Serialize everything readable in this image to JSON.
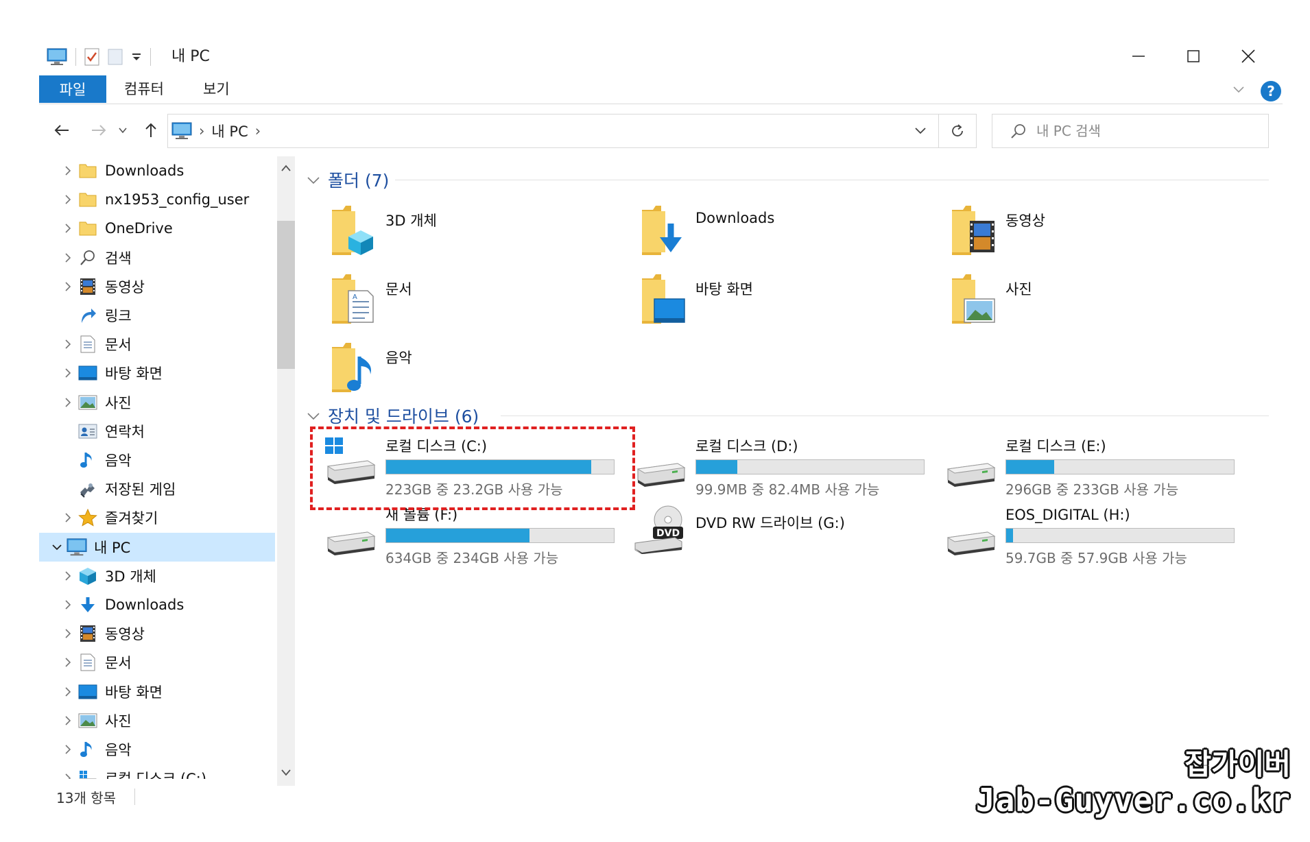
{
  "window": {
    "title": "내 PC"
  },
  "ribbon": {
    "tabs": [
      {
        "label": "파일"
      },
      {
        "label": "컴퓨터"
      },
      {
        "label": "보기"
      }
    ]
  },
  "address_bar": {
    "path": [
      "내 PC"
    ]
  },
  "search": {
    "placeholder": "내 PC 검색"
  },
  "nav_tree": [
    {
      "label": "Downloads",
      "icon": "folder-yellow-icon",
      "expandable": true
    },
    {
      "label": "nx1953_config_user",
      "icon": "folder-yellow-icon",
      "expandable": true
    },
    {
      "label": "OneDrive",
      "icon": "folder-yellow-icon",
      "expandable": true
    },
    {
      "label": "검색",
      "icon": "search-icon",
      "expandable": true
    },
    {
      "label": "동영상",
      "icon": "videos-icon",
      "expandable": true
    },
    {
      "label": "링크",
      "icon": "link-arrow-icon",
      "expandable": false
    },
    {
      "label": "문서",
      "icon": "document-icon",
      "expandable": true
    },
    {
      "label": "바탕 화면",
      "icon": "desktop-icon",
      "expandable": true
    },
    {
      "label": "사진",
      "icon": "pictures-icon",
      "expandable": true
    },
    {
      "label": "연락처",
      "icon": "contacts-icon",
      "expandable": false
    },
    {
      "label": "음악",
      "icon": "music-icon",
      "expandable": false
    },
    {
      "label": "저장된 게임",
      "icon": "saved-games-icon",
      "expandable": false
    },
    {
      "label": "즐겨찾기",
      "icon": "favorites-star-icon",
      "expandable": true
    },
    {
      "label": "내 PC",
      "icon": "this-pc-icon",
      "expanded": true,
      "selected": true
    },
    {
      "label": "3D 개체",
      "icon": "3d-objects-icon",
      "expandable": true
    },
    {
      "label": "Downloads",
      "icon": "download-arrow-icon",
      "expandable": true
    },
    {
      "label": "동영상",
      "icon": "videos-icon",
      "expandable": true
    },
    {
      "label": "문서",
      "icon": "document-icon",
      "expandable": true
    },
    {
      "label": "바탕 화면",
      "icon": "desktop-icon",
      "expandable": true
    },
    {
      "label": "사진",
      "icon": "pictures-icon",
      "expandable": true
    },
    {
      "label": "음악",
      "icon": "music-icon",
      "expandable": true
    },
    {
      "label": "로컬 디스크 (C:)",
      "icon": "windows-drive-icon",
      "expandable": true
    }
  ],
  "folders_group": {
    "title": "폴더 (7)",
    "items": [
      {
        "label": "3D 개체",
        "icon": "3d-objects-folder-icon"
      },
      {
        "label": "Downloads",
        "icon": "downloads-folder-icon"
      },
      {
        "label": "동영상",
        "icon": "videos-folder-icon"
      },
      {
        "label": "문서",
        "icon": "documents-folder-icon"
      },
      {
        "label": "바탕 화면",
        "icon": "desktop-folder-icon"
      },
      {
        "label": "사진",
        "icon": "pictures-folder-icon"
      },
      {
        "label": "음악",
        "icon": "music-folder-icon"
      }
    ]
  },
  "drives_group": {
    "title": "장치 및 드라이브 (6)",
    "items": [
      {
        "label": "로컬 디스크 (C:)",
        "free_text": "223GB 중 23.2GB 사용 가능",
        "used_fraction": 0.9,
        "icon": "windows-drive-icon",
        "has_bar": true
      },
      {
        "label": "로컬 디스크 (D:)",
        "free_text": "99.9MB 중 82.4MB 사용 가능",
        "used_fraction": 0.18,
        "icon": "hard-drive-icon",
        "has_bar": true
      },
      {
        "label": "로컬 디스크 (E:)",
        "free_text": "296GB 중 233GB 사용 가능",
        "used_fraction": 0.21,
        "icon": "hard-drive-icon",
        "has_bar": true
      },
      {
        "label": "새 볼륨 (F:)",
        "free_text": "634GB 중 234GB 사용 가능",
        "used_fraction": 0.63,
        "icon": "hard-drive-icon",
        "has_bar": true
      },
      {
        "label": "DVD RW 드라이브 (G:)",
        "free_text": "",
        "used_fraction": 0,
        "icon": "dvd-drive-icon",
        "has_bar": false
      },
      {
        "label": "EOS_DIGITAL (H:)",
        "free_text": "59.7GB 중 57.9GB 사용 가능",
        "used_fraction": 0.03,
        "icon": "hard-drive-icon",
        "has_bar": true
      }
    ]
  },
  "status_bar": {
    "item_count": "13개 항목"
  },
  "watermark": {
    "line1": "잡가이버",
    "line2": "Jab-Guyver.co.kr"
  },
  "colors": {
    "accent": "#1979ca",
    "drive_fill": "#26a0da",
    "selected_bg": "#cce8ff",
    "highlight": "#e02020"
  }
}
